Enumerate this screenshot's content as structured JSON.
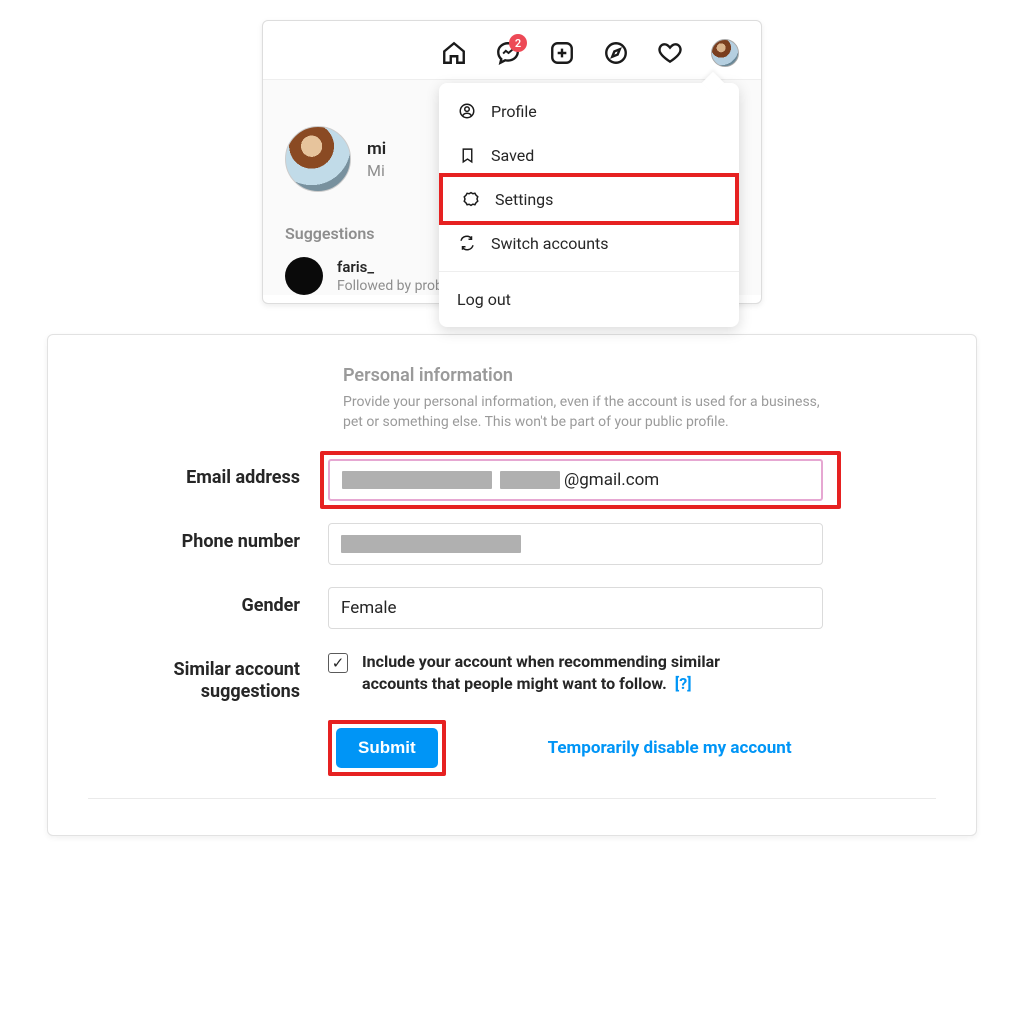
{
  "nav": {
    "badge_count": "2"
  },
  "dropdown": {
    "profile": "Profile",
    "saved": "Saved",
    "settings": "Settings",
    "switch": "Switch accounts",
    "logout": "Log out"
  },
  "feed": {
    "username": "mi",
    "display_name": "Mi",
    "suggestions_title": "Suggestions",
    "sugg_username": "faris_",
    "sugg_sub": "Followed by probo.dwi"
  },
  "form": {
    "section_title": "Personal information",
    "section_desc": "Provide your personal information, even if the account is used for a business, pet or something else. This won't be part of your public profile.",
    "email_label": "Email address",
    "email_suffix": "@gmail.com",
    "phone_label": "Phone number",
    "gender_label": "Gender",
    "gender_value": "Female",
    "similar_label": "Similar account suggestions",
    "similar_desc": "Include your account when recommending similar accounts that people might want to follow.",
    "help": "[?]",
    "submit": "Submit",
    "disable": "Temporarily disable my account"
  }
}
